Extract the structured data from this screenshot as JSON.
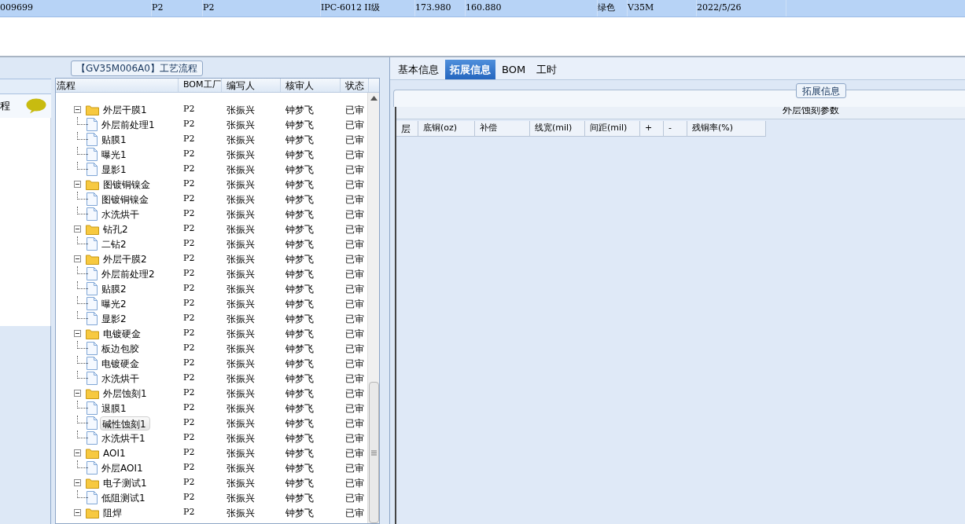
{
  "top_row": {
    "cells": [
      "009699",
      "P2",
      "P2",
      "IPC-6012 II级",
      "173.980",
      "160.880",
      "绿色",
      "V35M",
      "2022/5/26"
    ]
  },
  "left_panel": {
    "title": "程"
  },
  "process": {
    "title": "【GV35M006A0】工艺流程",
    "columns": [
      "流程",
      "BOM工厂",
      "编写人",
      "核审人",
      "状态"
    ],
    "rows": [
      {
        "kind": "folder",
        "name": "外层干膜1",
        "bom": "P2",
        "writer": "张振兴",
        "reviewer": "钟梦飞",
        "status": "已审",
        "expanded": true,
        "selected": false,
        "children": [
          {
            "kind": "file",
            "name": "外层前处理1",
            "bom": "P2",
            "writer": "张振兴",
            "reviewer": "钟梦飞",
            "status": "已审",
            "selected": false
          },
          {
            "kind": "file",
            "name": "贴膜1",
            "bom": "P2",
            "writer": "张振兴",
            "reviewer": "钟梦飞",
            "status": "已审",
            "selected": false
          },
          {
            "kind": "file",
            "name": "曝光1",
            "bom": "P2",
            "writer": "张振兴",
            "reviewer": "钟梦飞",
            "status": "已审",
            "selected": false
          },
          {
            "kind": "file",
            "name": "显影1",
            "bom": "P2",
            "writer": "张振兴",
            "reviewer": "钟梦飞",
            "status": "已审",
            "selected": false
          }
        ]
      },
      {
        "kind": "folder",
        "name": "图镀铜镍金",
        "bom": "P2",
        "writer": "张振兴",
        "reviewer": "钟梦飞",
        "status": "已审",
        "expanded": true,
        "selected": false,
        "children": [
          {
            "kind": "file",
            "name": "图镀铜镍金",
            "bom": "P2",
            "writer": "张振兴",
            "reviewer": "钟梦飞",
            "status": "已审",
            "selected": false
          },
          {
            "kind": "file",
            "name": "水洗烘干",
            "bom": "P2",
            "writer": "张振兴",
            "reviewer": "钟梦飞",
            "status": "已审",
            "selected": false
          }
        ]
      },
      {
        "kind": "folder",
        "name": "钻孔2",
        "bom": "P2",
        "writer": "张振兴",
        "reviewer": "钟梦飞",
        "status": "已审",
        "expanded": true,
        "selected": false,
        "children": [
          {
            "kind": "file",
            "name": "二钻2",
            "bom": "P2",
            "writer": "张振兴",
            "reviewer": "钟梦飞",
            "status": "已审",
            "selected": false
          }
        ]
      },
      {
        "kind": "folder",
        "name": "外层干膜2",
        "bom": "P2",
        "writer": "张振兴",
        "reviewer": "钟梦飞",
        "status": "已审",
        "expanded": true,
        "selected": false,
        "children": [
          {
            "kind": "file",
            "name": "外层前处理2",
            "bom": "P2",
            "writer": "张振兴",
            "reviewer": "钟梦飞",
            "status": "已审",
            "selected": false
          },
          {
            "kind": "file",
            "name": "贴膜2",
            "bom": "P2",
            "writer": "张振兴",
            "reviewer": "钟梦飞",
            "status": "已审",
            "selected": false
          },
          {
            "kind": "file",
            "name": "曝光2",
            "bom": "P2",
            "writer": "张振兴",
            "reviewer": "钟梦飞",
            "status": "已审",
            "selected": false
          },
          {
            "kind": "file",
            "name": "显影2",
            "bom": "P2",
            "writer": "张振兴",
            "reviewer": "钟梦飞",
            "status": "已审",
            "selected": false
          }
        ]
      },
      {
        "kind": "folder",
        "name": "电镀硬金",
        "bom": "P2",
        "writer": "张振兴",
        "reviewer": "钟梦飞",
        "status": "已审",
        "expanded": true,
        "selected": false,
        "children": [
          {
            "kind": "file",
            "name": "板边包胶",
            "bom": "P2",
            "writer": "张振兴",
            "reviewer": "钟梦飞",
            "status": "已审",
            "selected": false
          },
          {
            "kind": "file",
            "name": "电镀硬金",
            "bom": "P2",
            "writer": "张振兴",
            "reviewer": "钟梦飞",
            "status": "已审",
            "selected": false
          },
          {
            "kind": "file",
            "name": "水洗烘干",
            "bom": "P2",
            "writer": "张振兴",
            "reviewer": "钟梦飞",
            "status": "已审",
            "selected": false
          }
        ]
      },
      {
        "kind": "folder",
        "name": "外层蚀刻1",
        "bom": "P2",
        "writer": "张振兴",
        "reviewer": "钟梦飞",
        "status": "已审",
        "expanded": true,
        "selected": false,
        "children": [
          {
            "kind": "file",
            "name": "退膜1",
            "bom": "P2",
            "writer": "张振兴",
            "reviewer": "钟梦飞",
            "status": "已审",
            "selected": false
          },
          {
            "kind": "file",
            "name": "碱性蚀刻1",
            "bom": "P2",
            "writer": "张振兴",
            "reviewer": "钟梦飞",
            "status": "已审",
            "selected": true
          },
          {
            "kind": "file",
            "name": "水洗烘干1",
            "bom": "P2",
            "writer": "张振兴",
            "reviewer": "钟梦飞",
            "status": "已审",
            "selected": false
          }
        ]
      },
      {
        "kind": "folder",
        "name": "AOI1",
        "bom": "P2",
        "writer": "张振兴",
        "reviewer": "钟梦飞",
        "status": "已审",
        "expanded": true,
        "selected": false,
        "children": [
          {
            "kind": "file",
            "name": "外层AOI1",
            "bom": "P2",
            "writer": "张振兴",
            "reviewer": "钟梦飞",
            "status": "已审",
            "selected": false
          }
        ]
      },
      {
        "kind": "folder",
        "name": "电子测试1",
        "bom": "P2",
        "writer": "张振兴",
        "reviewer": "钟梦飞",
        "status": "已审",
        "expanded": true,
        "selected": false,
        "children": [
          {
            "kind": "file",
            "name": "低阻测试1",
            "bom": "P2",
            "writer": "张振兴",
            "reviewer": "钟梦飞",
            "status": "已审",
            "selected": false
          }
        ]
      },
      {
        "kind": "folder",
        "name": "阻焊",
        "bom": "P2",
        "writer": "张振兴",
        "reviewer": "钟梦飞",
        "status": "已审",
        "expanded": true,
        "selected": false
      }
    ]
  },
  "tabs": [
    {
      "label": "基本信息",
      "selected": false
    },
    {
      "label": "拓展信息",
      "selected": true
    },
    {
      "label": "BOM",
      "selected": false
    },
    {
      "label": "工时",
      "selected": false
    }
  ],
  "extension": {
    "legend": "拓展信息",
    "table_title": "外层蚀刻参数",
    "columns": [
      "层",
      "底铜(oz)",
      "补偿",
      "线宽(mil)",
      "间距(mil)",
      "+",
      "-",
      "残铜率(%)"
    ]
  }
}
